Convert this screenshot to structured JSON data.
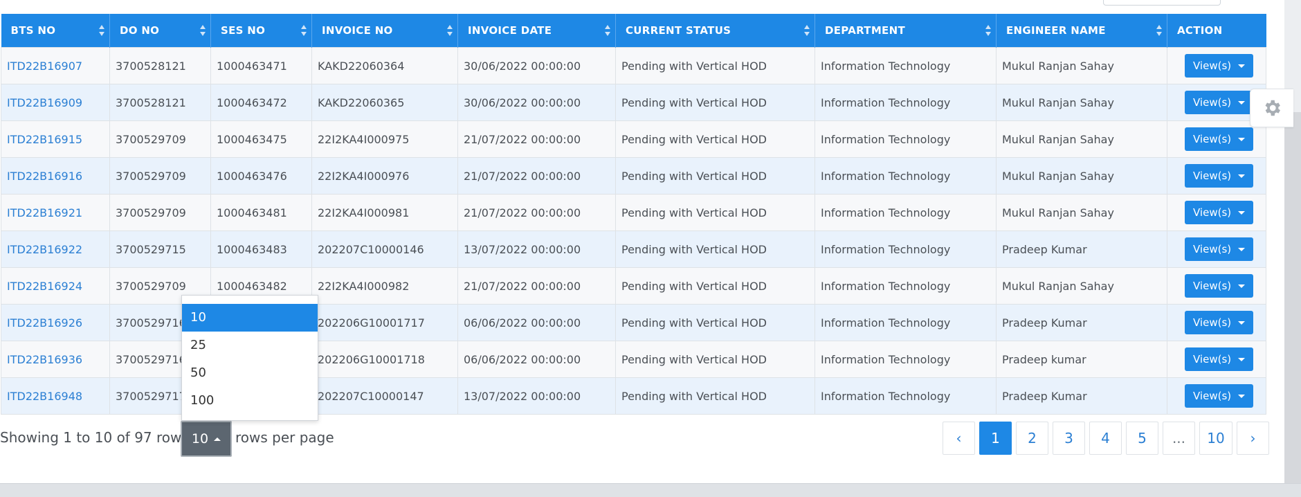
{
  "table": {
    "columns": [
      "BTS NO",
      "DO NO",
      "SES NO",
      "INVOICE NO",
      "INVOICE DATE",
      "CURRENT STATUS",
      "DEPARTMENT",
      "ENGINEER NAME",
      "ACTION"
    ],
    "rows": [
      {
        "bts": "ITD22B16907",
        "do": "3700528121",
        "ses": "1000463471",
        "invoice": "KAKD22060364",
        "date": "30/06/2022 00:00:00",
        "status": "Pending with Vertical HOD",
        "dept": "Information Technology",
        "engineer": "Mukul Ranjan Sahay",
        "action": "View(s)"
      },
      {
        "bts": "ITD22B16909",
        "do": "3700528121",
        "ses": "1000463472",
        "invoice": "KAKD22060365",
        "date": "30/06/2022 00:00:00",
        "status": "Pending with Vertical HOD",
        "dept": "Information Technology",
        "engineer": "Mukul Ranjan Sahay",
        "action": "View(s)"
      },
      {
        "bts": "ITD22B16915",
        "do": "3700529709",
        "ses": "1000463475",
        "invoice": "22I2KA4I000975",
        "date": "21/07/2022 00:00:00",
        "status": "Pending with Vertical HOD",
        "dept": "Information Technology",
        "engineer": "Mukul Ranjan Sahay",
        "action": "View(s)"
      },
      {
        "bts": "ITD22B16916",
        "do": "3700529709",
        "ses": "1000463476",
        "invoice": "22I2KA4I000976",
        "date": "21/07/2022 00:00:00",
        "status": "Pending with Vertical HOD",
        "dept": "Information Technology",
        "engineer": "Mukul Ranjan Sahay",
        "action": "View(s)"
      },
      {
        "bts": "ITD22B16921",
        "do": "3700529709",
        "ses": "1000463481",
        "invoice": "22I2KA4I000981",
        "date": "21/07/2022 00:00:00",
        "status": "Pending with Vertical HOD",
        "dept": "Information Technology",
        "engineer": "Mukul Ranjan Sahay",
        "action": "View(s)"
      },
      {
        "bts": "ITD22B16922",
        "do": "3700529715",
        "ses": "1000463483",
        "invoice": "202207C10000146",
        "date": "13/07/2022 00:00:00",
        "status": "Pending with Vertical HOD",
        "dept": "Information Technology",
        "engineer": "Pradeep Kumar",
        "action": "View(s)"
      },
      {
        "bts": "ITD22B16924",
        "do": "3700529709",
        "ses": "1000463482",
        "invoice": "22I2KA4I000982",
        "date": "21/07/2022 00:00:00",
        "status": "Pending with Vertical HOD",
        "dept": "Information Technology",
        "engineer": "Mukul Ranjan Sahay",
        "action": "View(s)"
      },
      {
        "bts": "ITD22B16926",
        "do": "3700529716",
        "ses": "",
        "invoice": "202206G10001717",
        "date": "06/06/2022 00:00:00",
        "status": "Pending with Vertical HOD",
        "dept": "Information Technology",
        "engineer": "Pradeep Kumar",
        "action": "View(s)"
      },
      {
        "bts": "ITD22B16936",
        "do": "3700529716",
        "ses": "",
        "invoice": "202206G10001718",
        "date": "06/06/2022 00:00:00",
        "status": "Pending with Vertical HOD",
        "dept": "Information Technology",
        "engineer": "Pradeep kumar",
        "action": "View(s)"
      },
      {
        "bts": "ITD22B16948",
        "do": "3700529717",
        "ses": "",
        "invoice": "202207C10000147",
        "date": "13/07/2022 00:00:00",
        "status": "Pending with Vertical HOD",
        "dept": "Information Technology",
        "engineer": "Pradeep Kumar",
        "action": "View(s)"
      }
    ]
  },
  "footer": {
    "showing_text": "Showing 1 to 10 of 97 rows",
    "page_size": "10",
    "rows_per_page_text": "rows per page",
    "page_size_options": [
      "10",
      "25",
      "50",
      "100"
    ],
    "selected_option": "10"
  },
  "pagination": {
    "prev": "‹",
    "pages": [
      "1",
      "2",
      "3",
      "4",
      "5",
      "...",
      "10"
    ],
    "active": "1",
    "next": "›"
  },
  "icons": {
    "settings": "gear-icon",
    "sort": "sort-icon"
  },
  "colors": {
    "header": "#1e88e5",
    "link": "#2b7fd3",
    "active": "#1e88e5"
  }
}
